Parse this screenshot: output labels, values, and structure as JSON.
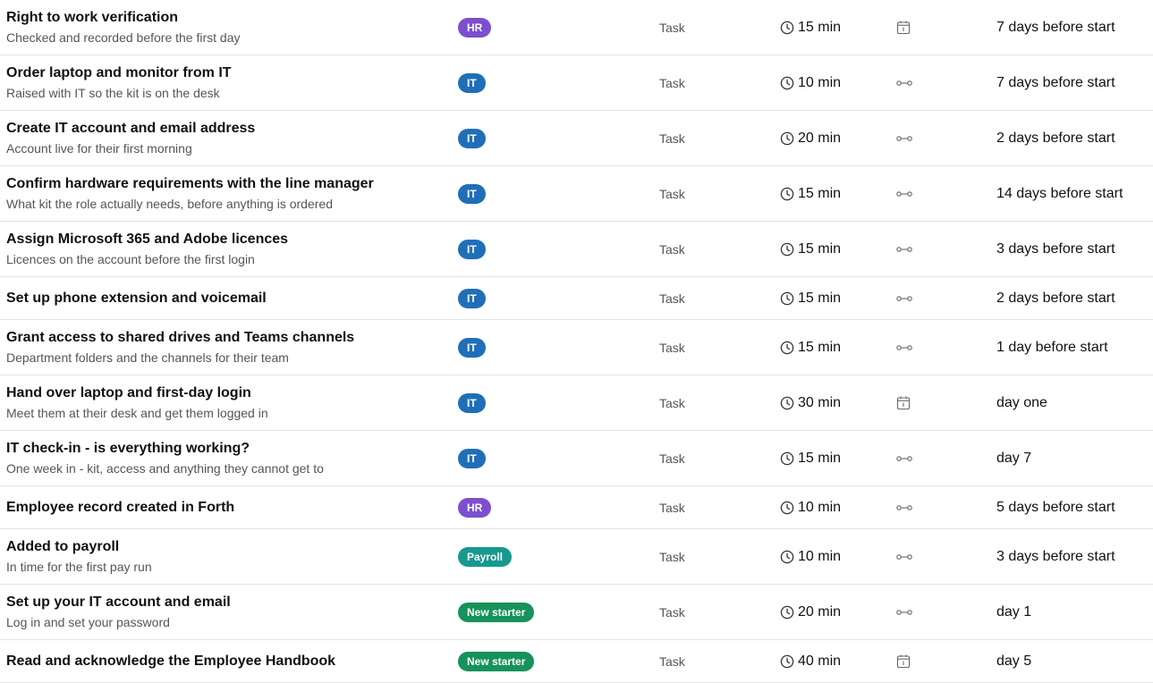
{
  "colors": {
    "HR": "#7b4fcf",
    "IT": "#1f6fb8",
    "Payroll": "#17998f",
    "New starter": "#16935a"
  },
  "rows": [
    {
      "title": "Right to work verification",
      "subtitle": "Checked and recorded before the first day",
      "badge": "HR",
      "type": "Task",
      "duration": "15 min",
      "mode_icon": "calendar-icon",
      "when": "7 days before start"
    },
    {
      "title": "Order laptop and monitor from IT",
      "subtitle": "Raised with IT so the kit is on the desk",
      "badge": "IT",
      "type": "Task",
      "duration": "10 min",
      "mode_icon": "link-icon",
      "when": "7 days before start"
    },
    {
      "title": "Create IT account and email address",
      "subtitle": "Account live for their first morning",
      "badge": "IT",
      "type": "Task",
      "duration": "20 min",
      "mode_icon": "link-icon",
      "when": "2 days before start"
    },
    {
      "title": "Confirm hardware requirements with the line manager",
      "subtitle": "What kit the role actually needs, before anything is ordered",
      "badge": "IT",
      "type": "Task",
      "duration": "15 min",
      "mode_icon": "link-icon",
      "when": "14 days before start"
    },
    {
      "title": "Assign Microsoft 365 and Adobe licences",
      "subtitle": "Licences on the account before the first login",
      "badge": "IT",
      "type": "Task",
      "duration": "15 min",
      "mode_icon": "link-icon",
      "when": "3 days before start"
    },
    {
      "title": "Set up phone extension and voicemail",
      "subtitle": "",
      "badge": "IT",
      "type": "Task",
      "duration": "15 min",
      "mode_icon": "link-icon",
      "when": "2 days before start"
    },
    {
      "title": "Grant access to shared drives and Teams channels",
      "subtitle": "Department folders and the channels for their team",
      "badge": "IT",
      "type": "Task",
      "duration": "15 min",
      "mode_icon": "link-icon",
      "when": "1 day before start"
    },
    {
      "title": "Hand over laptop and first-day login",
      "subtitle": "Meet them at their desk and get them logged in",
      "badge": "IT",
      "type": "Task",
      "duration": "30 min",
      "mode_icon": "calendar-icon",
      "when": "day one"
    },
    {
      "title": "IT check-in - is everything working?",
      "subtitle": "One week in - kit, access and anything they cannot get to",
      "badge": "IT",
      "type": "Task",
      "duration": "15 min",
      "mode_icon": "link-icon",
      "when": "day 7"
    },
    {
      "title": "Employee record created in Forth",
      "subtitle": "",
      "badge": "HR",
      "type": "Task",
      "duration": "10 min",
      "mode_icon": "link-icon",
      "when": "5 days before start"
    },
    {
      "title": "Added to payroll",
      "subtitle": "In time for the first pay run",
      "badge": "Payroll",
      "type": "Task",
      "duration": "10 min",
      "mode_icon": "link-icon",
      "when": "3 days before start"
    },
    {
      "title": "Set up your IT account and email",
      "subtitle": "Log in and set your password",
      "badge": "New starter",
      "type": "Task",
      "duration": "20 min",
      "mode_icon": "link-icon",
      "when": "day 1"
    },
    {
      "title": "Read and acknowledge the Employee Handbook",
      "subtitle": "",
      "badge": "New starter",
      "type": "Task",
      "duration": "40 min",
      "mode_icon": "calendar-icon",
      "when": "day 5"
    }
  ]
}
